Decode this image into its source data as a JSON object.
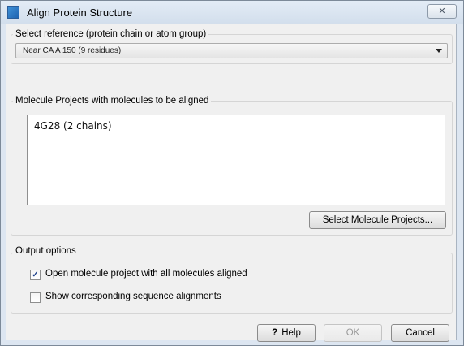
{
  "window": {
    "title": "Align Protein Structure",
    "close_glyph": "✕"
  },
  "reference": {
    "group_label": "Select reference (protein chain or atom group)",
    "selected": "Near CA A 150 (9 residues)"
  },
  "projects": {
    "group_label": "Molecule Projects with molecules to be aligned",
    "items": [
      "4G28 (2 chains)"
    ],
    "select_button": "Select Molecule Projects..."
  },
  "output": {
    "group_label": "Output options",
    "options": [
      {
        "label": "Open molecule project with all molecules aligned",
        "checked": true
      },
      {
        "label": "Show corresponding sequence alignments",
        "checked": false
      }
    ]
  },
  "buttons": {
    "help": "Help",
    "help_icon": "?",
    "ok": "OK",
    "cancel": "Cancel"
  }
}
